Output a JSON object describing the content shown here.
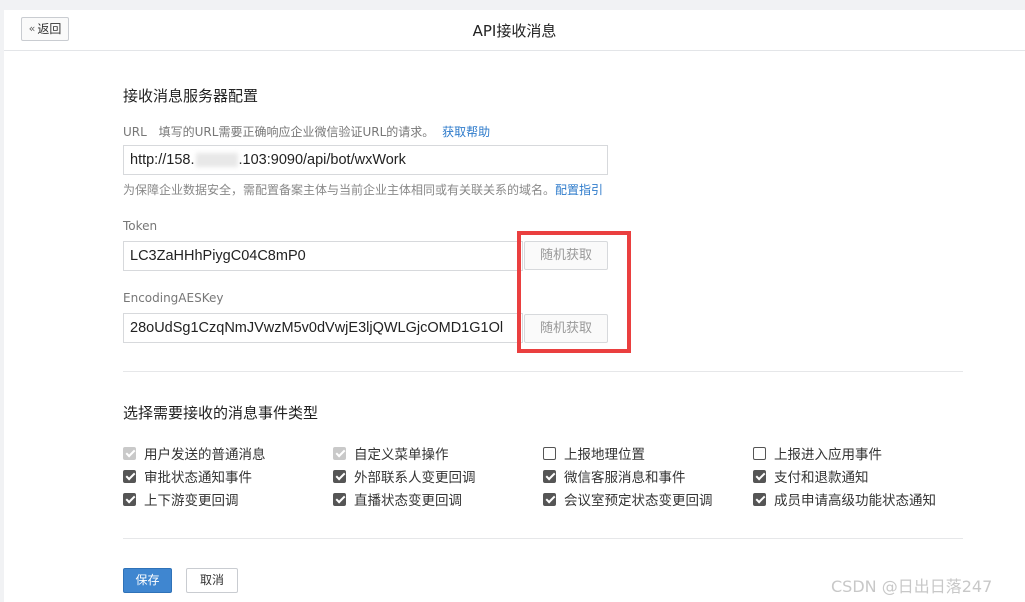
{
  "header": {
    "back_label": "返回",
    "title": "API接收消息"
  },
  "config": {
    "section_title": "接收消息服务器配置",
    "url": {
      "label": "URL",
      "desc": "填写的URL需要正确响应企业微信验证URL的请求。",
      "help_link": "获取帮助",
      "value_prefix": "http://158.",
      "value_suffix": ".103:9090/api/bot/wxWork",
      "hint": "为保障企业数据安全，需配置备案主体与当前企业主体相同或有关联关系的域名。",
      "hint_link": "配置指引"
    },
    "token": {
      "label": "Token",
      "value": "LC3ZaHHhPiygC04C8mP0",
      "button": "随机获取"
    },
    "aes": {
      "label": "EncodingAESKey",
      "value": "28oUdSg1CzqNmJVwzM5v0dVwjE3ljQWLGjcOMD1G1Ol",
      "button": "随机获取"
    }
  },
  "events": {
    "section_title": "选择需要接收的消息事件类型",
    "items": [
      {
        "label": "用户发送的普通消息",
        "checked": true,
        "disabled": true
      },
      {
        "label": "自定义菜单操作",
        "checked": true,
        "disabled": true
      },
      {
        "label": "上报地理位置",
        "checked": false,
        "disabled": false
      },
      {
        "label": "上报进入应用事件",
        "checked": false,
        "disabled": false
      },
      {
        "label": "审批状态通知事件",
        "checked": true,
        "disabled": false
      },
      {
        "label": "外部联系人变更回调",
        "checked": true,
        "disabled": false
      },
      {
        "label": "微信客服消息和事件",
        "checked": true,
        "disabled": false
      },
      {
        "label": "支付和退款通知",
        "checked": true,
        "disabled": false
      },
      {
        "label": "上下游变更回调",
        "checked": true,
        "disabled": false
      },
      {
        "label": "直播状态变更回调",
        "checked": true,
        "disabled": false
      },
      {
        "label": "会议室预定状态变更回调",
        "checked": true,
        "disabled": false
      },
      {
        "label": "成员申请高级功能状态通知",
        "checked": true,
        "disabled": false
      }
    ]
  },
  "footer": {
    "save_label": "保存",
    "cancel_label": "取消"
  },
  "watermark": "CSDN @日出日落247",
  "colors": {
    "link": "#2e7bcb",
    "primary": "#3f86d0",
    "highlight": "#ea3f3f"
  }
}
